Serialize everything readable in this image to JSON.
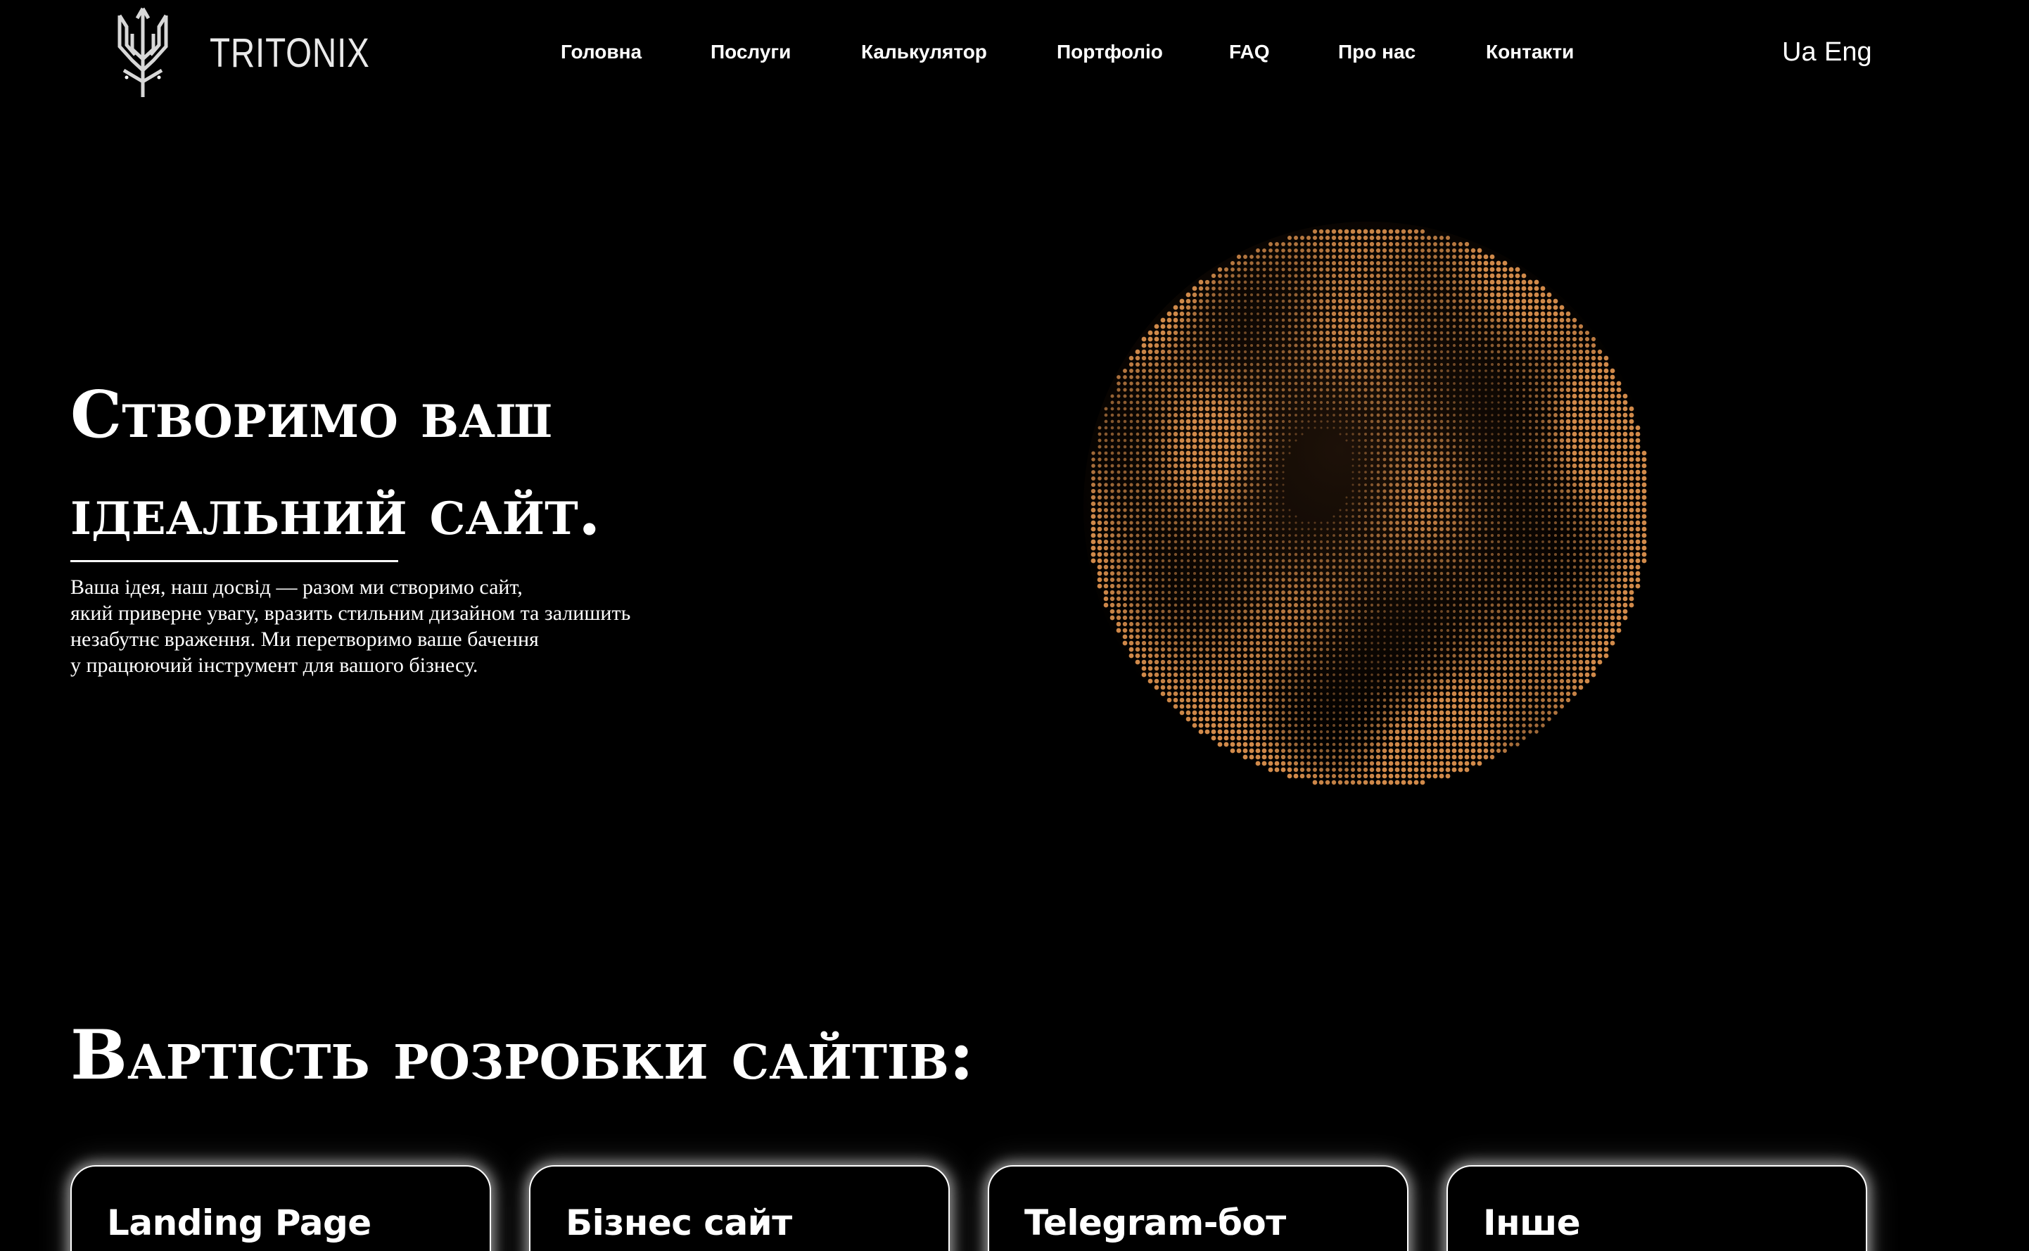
{
  "brand": {
    "name": "TRITONIX",
    "logo_icon": "trident-icon"
  },
  "nav": {
    "items": [
      {
        "label": "Головна"
      },
      {
        "label": "Послуги"
      },
      {
        "label": "Калькулятор"
      },
      {
        "label": "Портфоліо"
      },
      {
        "label": "FAQ"
      },
      {
        "label": "Про нас"
      },
      {
        "label": "Контакти"
      }
    ]
  },
  "language": {
    "ua": "Ua",
    "eng": "Eng"
  },
  "hero": {
    "title_lines": [
      "Створимо ваш",
      "ідеальний сайт."
    ],
    "description_lines": [
      "Ваша ідея, наш досвід — разом ми створимо сайт,",
      "який приверне увагу, вразить стильним дизайном та залишить",
      "незабутнє враження. Ми перетворимо ваше бачення",
      "у працюючий інструмент для вашого бізнесу."
    ],
    "visual_icon": "particle-sphere-icon",
    "accent_color": "#d18a4a"
  },
  "pricing": {
    "title": "Вартість розробки сайтів:",
    "cards": [
      {
        "title": "Landing Page"
      },
      {
        "title": "Бізнес сайт"
      },
      {
        "title": "Telegram-бот"
      },
      {
        "title": "Інше"
      }
    ]
  }
}
